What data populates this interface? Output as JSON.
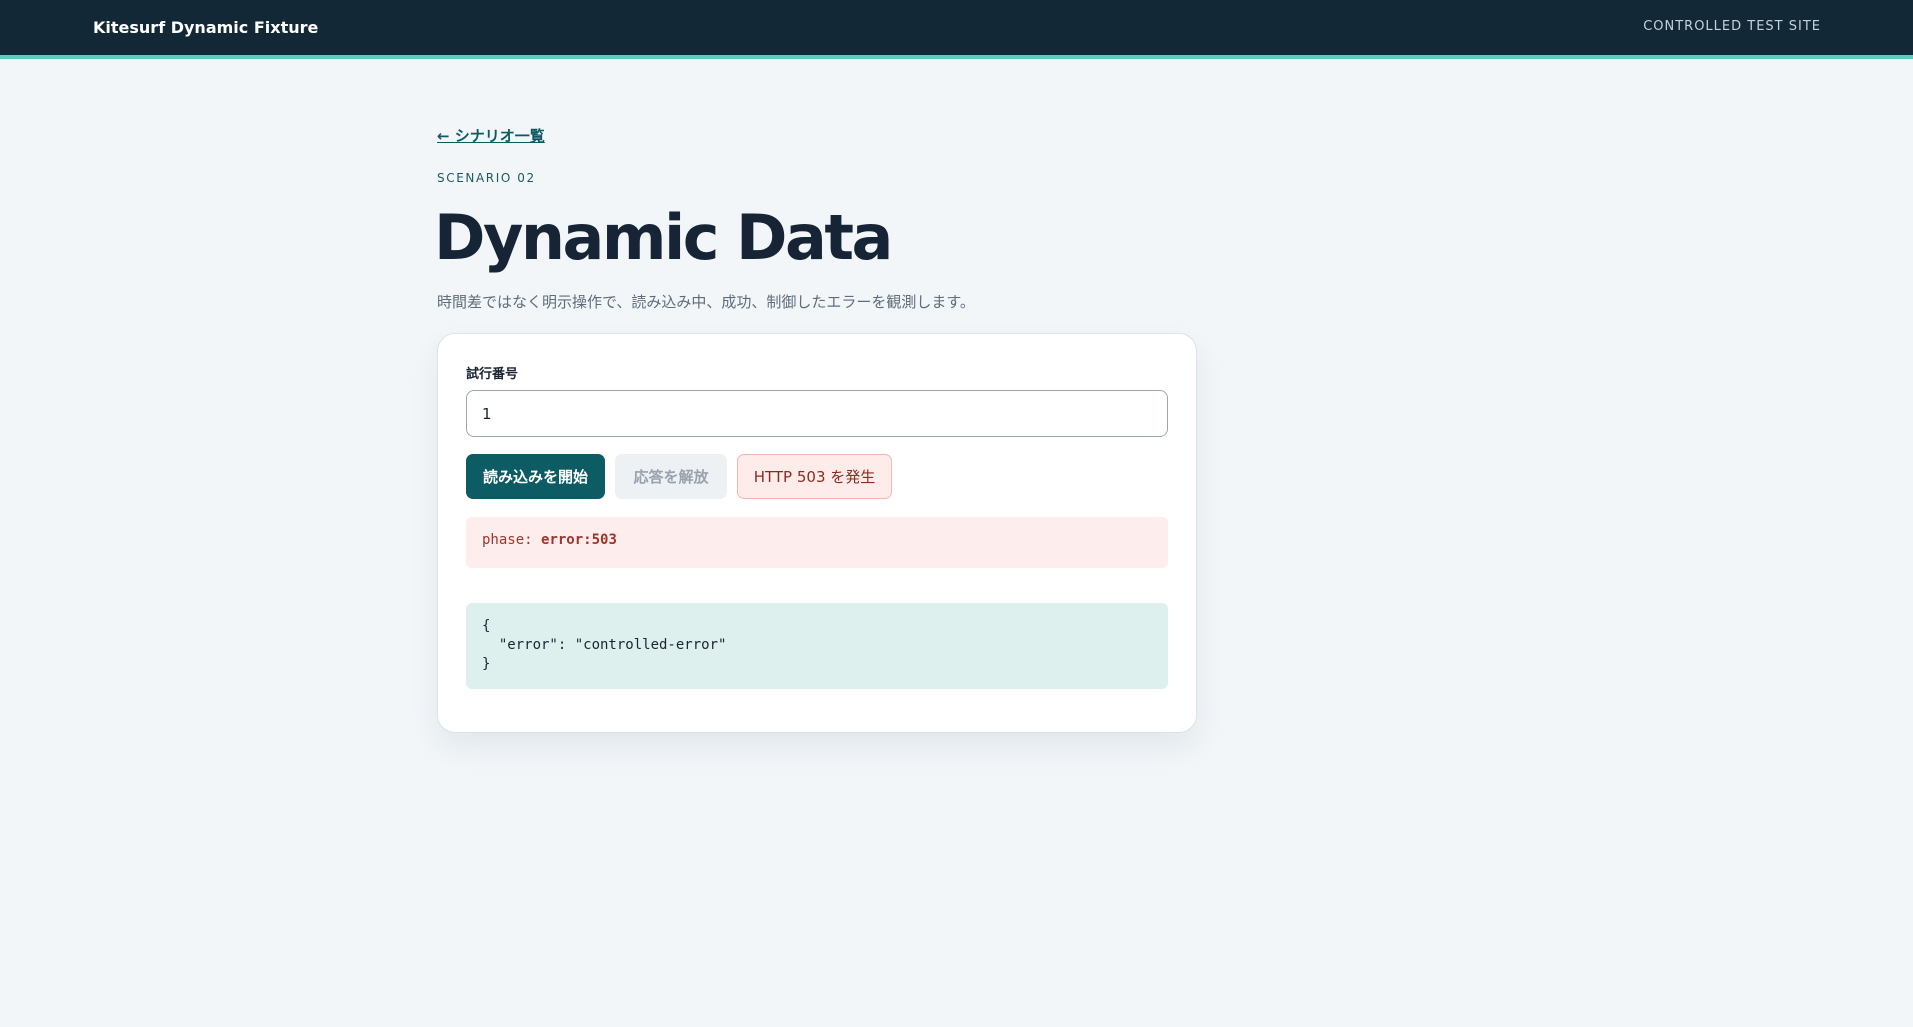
{
  "header": {
    "brand": "Kitesurf Dynamic Fixture",
    "site_label": "CONTROLLED TEST SITE",
    "accent_color": "#5fc9c0"
  },
  "nav": {
    "back_link": "← シナリオ一覧"
  },
  "page": {
    "eyebrow": "SCENARIO 02",
    "title": "Dynamic Data",
    "subtitle": "時間差ではなく明示操作で、読み込み中、成功、制御したエラーを観測します。"
  },
  "form": {
    "trial_label": "試行番号",
    "trial_value": "1"
  },
  "actions": {
    "start_label": "読み込みを開始",
    "release_label": "応答を解放",
    "error_label": "HTTP 503 を発生"
  },
  "status": {
    "phase_key": "phase: ",
    "phase_value": "error:503"
  },
  "response": {
    "body": "{\n  \"error\": \"controlled-error\"\n}"
  }
}
